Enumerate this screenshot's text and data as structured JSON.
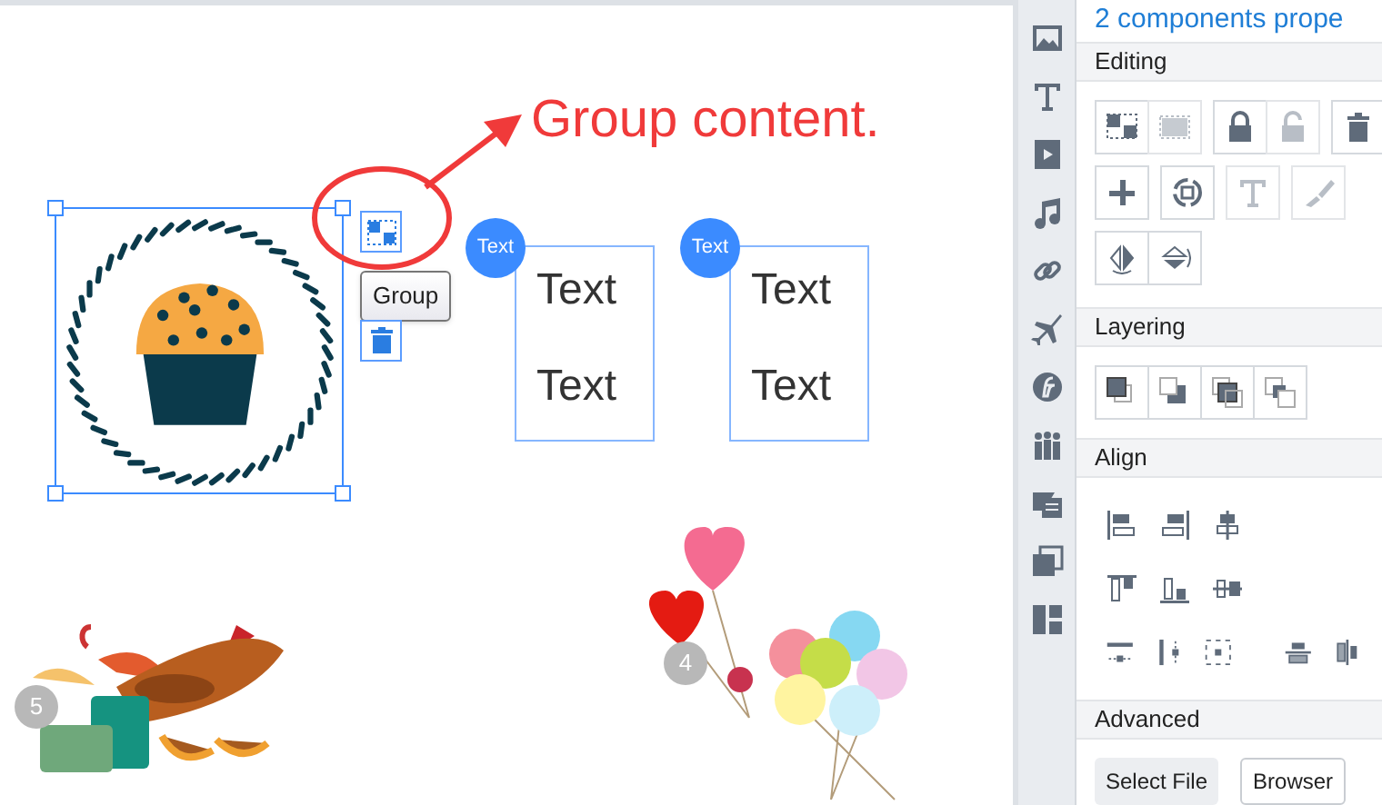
{
  "canvas": {
    "annotation": "Group content.",
    "group_tooltip": "Group",
    "text_components": [
      {
        "badge": "Text",
        "lines": [
          "Text",
          "Text"
        ]
      },
      {
        "badge": "Text",
        "lines": [
          "Text",
          "Text"
        ]
      }
    ],
    "stickers": [
      {
        "kind": "travel",
        "badge": "5"
      },
      {
        "kind": "balloons",
        "badge": "4"
      }
    ]
  },
  "panel": {
    "title": "2 components prope",
    "editing": {
      "title": "Editing",
      "rows": [
        [
          [
            {
              "kind": "group",
              "disabled": false
            },
            {
              "kind": "ungroup",
              "disabled": true
            }
          ],
          [
            {
              "kind": "lock",
              "disabled": false
            },
            {
              "kind": "unlock",
              "disabled": true
            }
          ],
          [
            {
              "kind": "delete",
              "disabled": false
            }
          ]
        ],
        [
          [
            {
              "kind": "add",
              "disabled": false
            }
          ],
          [
            {
              "kind": "rotate",
              "disabled": false
            }
          ],
          [
            {
              "kind": "text",
              "disabled": true
            }
          ],
          [
            {
              "kind": "brush",
              "disabled": true
            }
          ]
        ],
        [
          [
            {
              "kind": "flip-horizontal",
              "disabled": false
            },
            {
              "kind": "flip-vertical",
              "disabled": false
            }
          ]
        ]
      ]
    },
    "layering": {
      "title": "Layering"
    },
    "align": {
      "title": "Align"
    },
    "advanced": {
      "title": "Advanced",
      "buttons": [
        {
          "label": "Select File",
          "kind": "filled"
        },
        {
          "label": "Browser",
          "kind": "outlined"
        }
      ]
    }
  }
}
